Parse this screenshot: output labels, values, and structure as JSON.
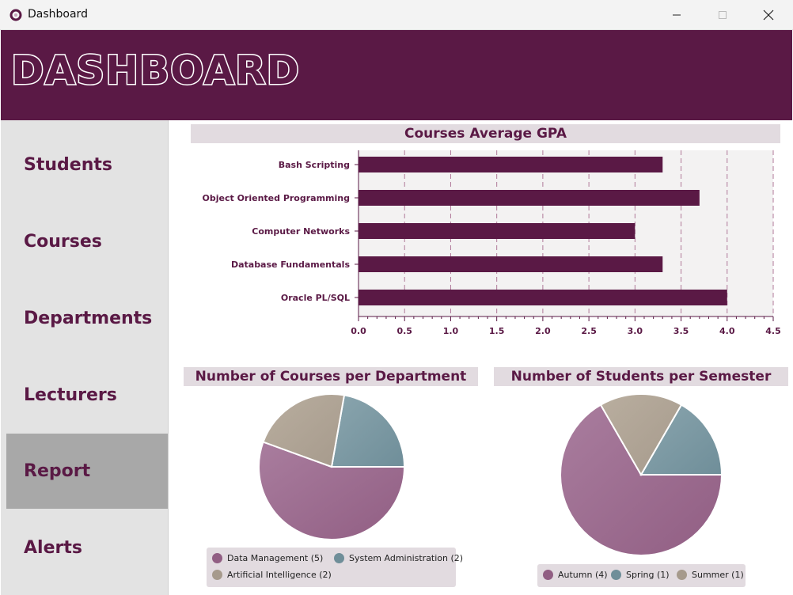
{
  "window": {
    "title": "Dashboard",
    "icon": "app-logo-icon",
    "controls": [
      "minimize-icon",
      "maximize-icon",
      "close-icon"
    ]
  },
  "header": {
    "title": "DASHBOARD"
  },
  "sidebar": {
    "items": [
      {
        "label": "Students",
        "active": false
      },
      {
        "label": "Courses",
        "active": false
      },
      {
        "label": "Departments",
        "active": false
      },
      {
        "label": "Lecturers",
        "active": false
      },
      {
        "label": "Report",
        "active": true
      },
      {
        "label": "Alerts",
        "active": false
      }
    ]
  },
  "colors": {
    "brand": "#5a1945",
    "bar": "#5a1945",
    "title_band": "#e2dbe0",
    "pie_mauve": "#915e83",
    "pie_teal": "#6f8e99",
    "pie_taupe": "#a69a8c"
  },
  "chart_data": [
    {
      "type": "bar",
      "orientation": "horizontal",
      "title": "Courses Average GPA",
      "categories": [
        "Bash Scripting",
        "Object Oriented Programming",
        "Computer Networks",
        "Database Fundamentals",
        "Oracle PL/SQL"
      ],
      "values": [
        3.3,
        3.7,
        3.0,
        3.3,
        4.0
      ],
      "xlim": [
        0,
        4.5
      ],
      "xticks": [
        "0.0",
        "0.5",
        "1.0",
        "1.5",
        "2.0",
        "2.5",
        "3.0",
        "3.5",
        "4.0",
        "4.5"
      ],
      "grid": "vertical dashed",
      "xlabel": "",
      "ylabel": ""
    },
    {
      "type": "pie",
      "title": "Number of Courses per Department",
      "labels": [
        "Data Management",
        "System Administration",
        "Artificial Intelligence"
      ],
      "values": [
        5,
        2,
        2
      ],
      "legend": [
        "Data Management (5)",
        "System Administration (2)",
        "Artificial Intelligence (2)"
      ],
      "legend_position": "bottom"
    },
    {
      "type": "pie",
      "title": "Number of Students per Semester",
      "labels": [
        "Autumn",
        "Spring",
        "Summer"
      ],
      "values": [
        4,
        1,
        1
      ],
      "legend": [
        "Autumn (4)",
        "Spring (1)",
        "Summer (1)"
      ],
      "legend_position": "bottom"
    }
  ]
}
